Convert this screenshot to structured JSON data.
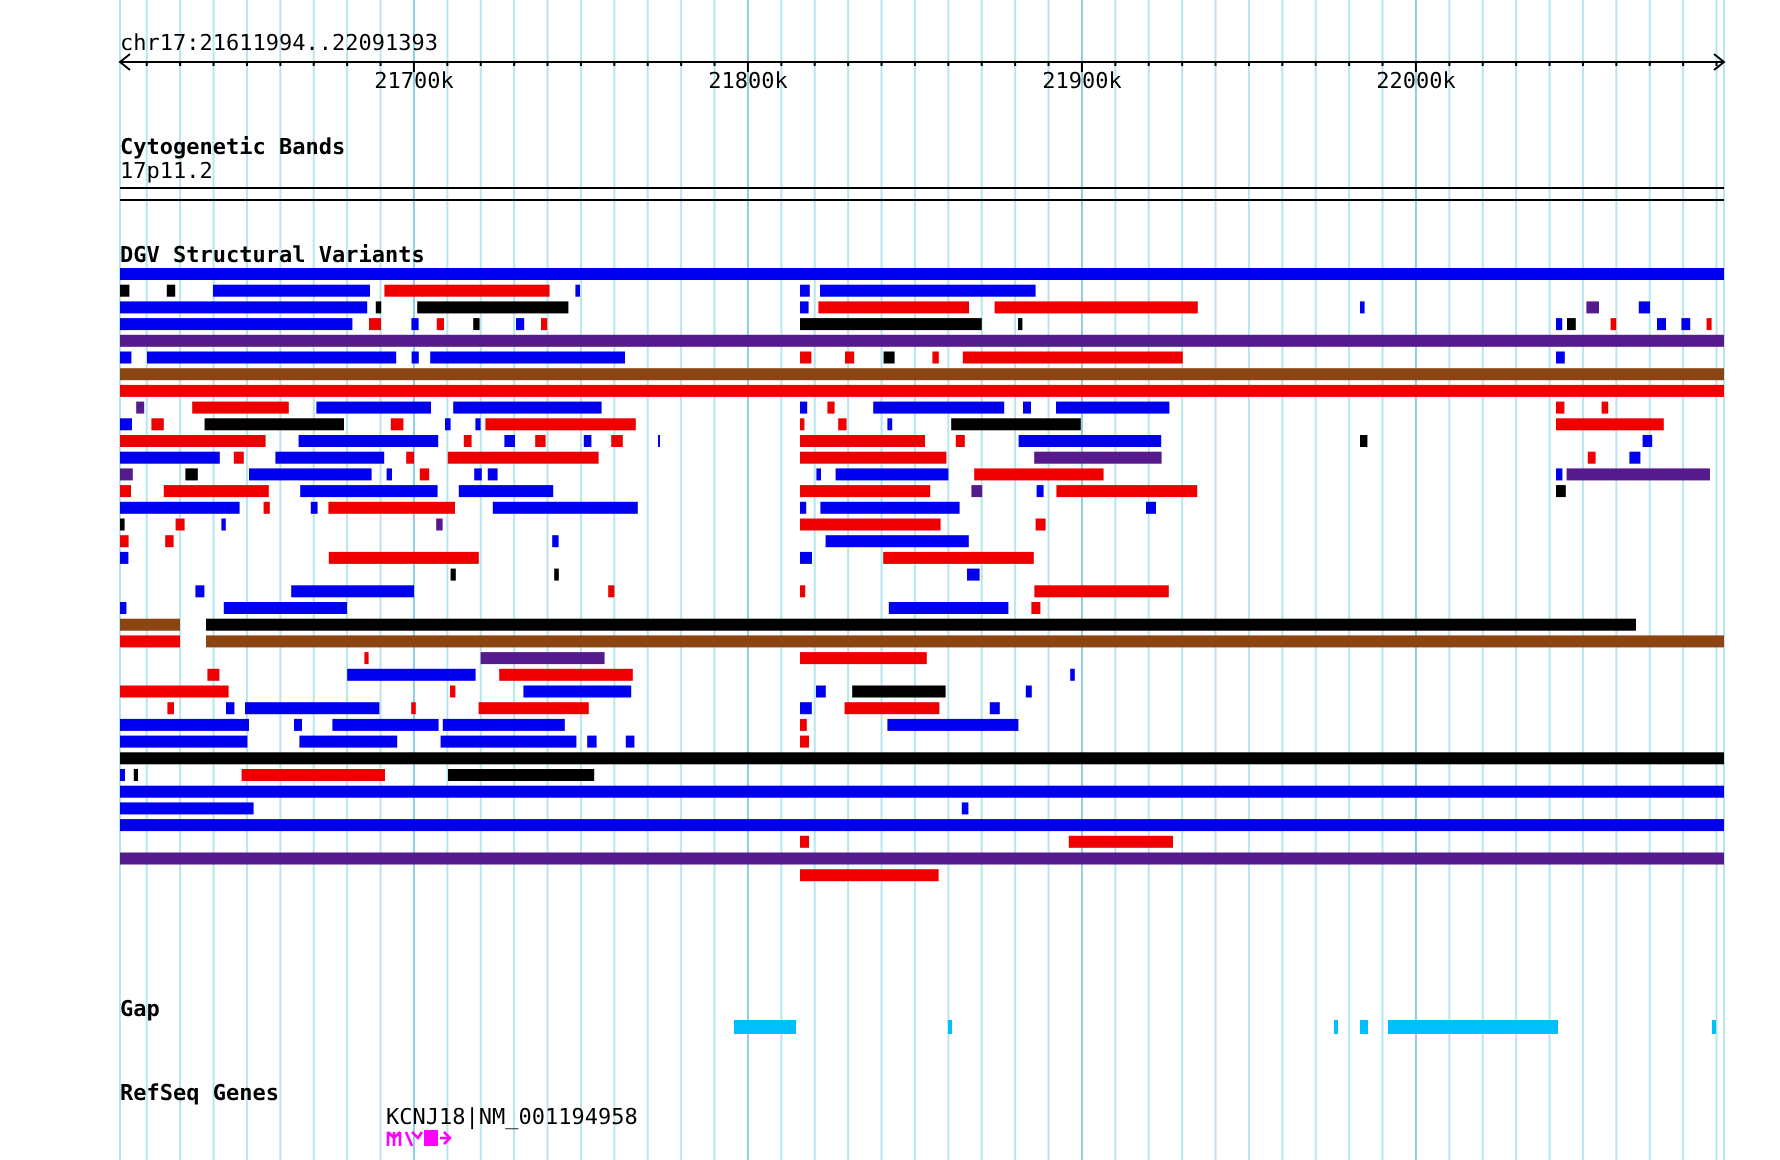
{
  "ruler": {
    "location": "chr17:21611994..22091393",
    "ticks": [
      "21700k",
      "21800k",
      "21900k",
      "22000k"
    ]
  },
  "tracks": [
    {
      "kind": "cytoband",
      "title": "Cytogenetic Bands",
      "label": "17p11.2"
    },
    {
      "kind": "variants",
      "title": "DGV Structural Variants"
    },
    {
      "kind": "gap",
      "title": "Gap"
    },
    {
      "kind": "genes",
      "title": "RefSeq Genes",
      "label": "KCNJ18|NM_001194958"
    }
  ]
}
